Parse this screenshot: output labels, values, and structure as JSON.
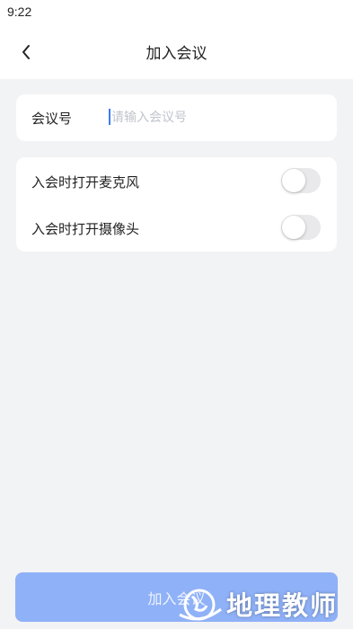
{
  "status_bar": {
    "time": "9:22"
  },
  "header": {
    "title": "加入会议",
    "back_icon": "chevron-left-icon"
  },
  "meeting_field": {
    "label": "会议号",
    "value": "",
    "placeholder": "请输入会议号"
  },
  "options": [
    {
      "label": "入会时打开麦克风",
      "enabled": false
    },
    {
      "label": "入会时打开摄像头",
      "enabled": false
    }
  ],
  "join_button": {
    "label": "加入会议",
    "color": "#8fb1f7"
  },
  "watermark": {
    "text": "地理教师"
  },
  "colors": {
    "accent": "#3b7cf6",
    "background": "#f2f3f5",
    "toggle_off": "#e9e9eb"
  }
}
